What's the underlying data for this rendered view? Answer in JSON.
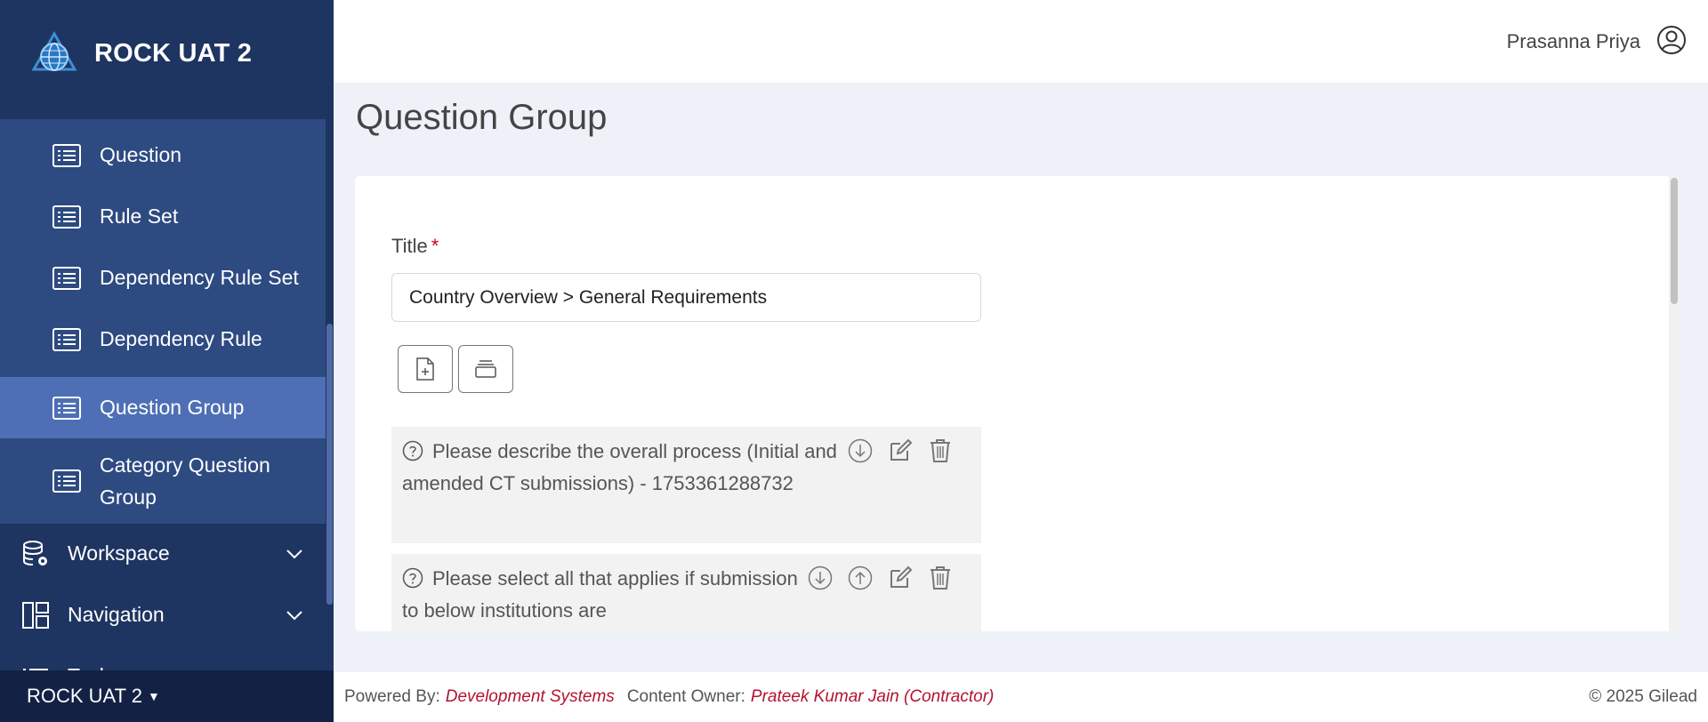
{
  "app": {
    "title": "ROCK UAT 2",
    "environment_label": "ROCK UAT 2"
  },
  "sidebar": {
    "sub_items": [
      {
        "label": "Question",
        "icon": "list-icon",
        "active": false
      },
      {
        "label": "Rule Set",
        "icon": "list-icon",
        "active": false
      },
      {
        "label": "Dependency Rule Set",
        "icon": "list-icon",
        "active": false
      },
      {
        "label": "Dependency Rule",
        "icon": "list-icon",
        "active": false
      },
      {
        "label": "Question Group",
        "icon": "list-icon",
        "active": true
      },
      {
        "label": "Category Question Group",
        "icon": "list-icon",
        "active": false
      }
    ],
    "main_items": [
      {
        "label": "Workspace",
        "icon": "database-gear-icon"
      },
      {
        "label": "Navigation",
        "icon": "layout-icon"
      },
      {
        "label": "Tasks",
        "icon": "list-icon"
      }
    ]
  },
  "header": {
    "username": "Prasanna Priya"
  },
  "page": {
    "title": "Question Group"
  },
  "form": {
    "title_label": "Title",
    "required_marker": "*",
    "title_value": "Country Overview > General Requirements"
  },
  "questions": [
    {
      "text": "Please describe the overall process (Initial and amended CT submissions) - 1753361288732"
    },
    {
      "text": "Please select all that applies if submission to below institutions are"
    }
  ],
  "footer": {
    "powered_by_label": "Powered By:",
    "powered_by_value": "Development Systems",
    "owner_label": "Content Owner:",
    "owner_value": "Prateek Kumar Jain (Contractor)",
    "copyright": "© 2025 Gilead"
  },
  "colors": {
    "sidebar": "#1e3461",
    "submenu": "#2d4a81",
    "active": "#4e6fb5",
    "link": "#b5122f",
    "required": "#d0021b"
  }
}
